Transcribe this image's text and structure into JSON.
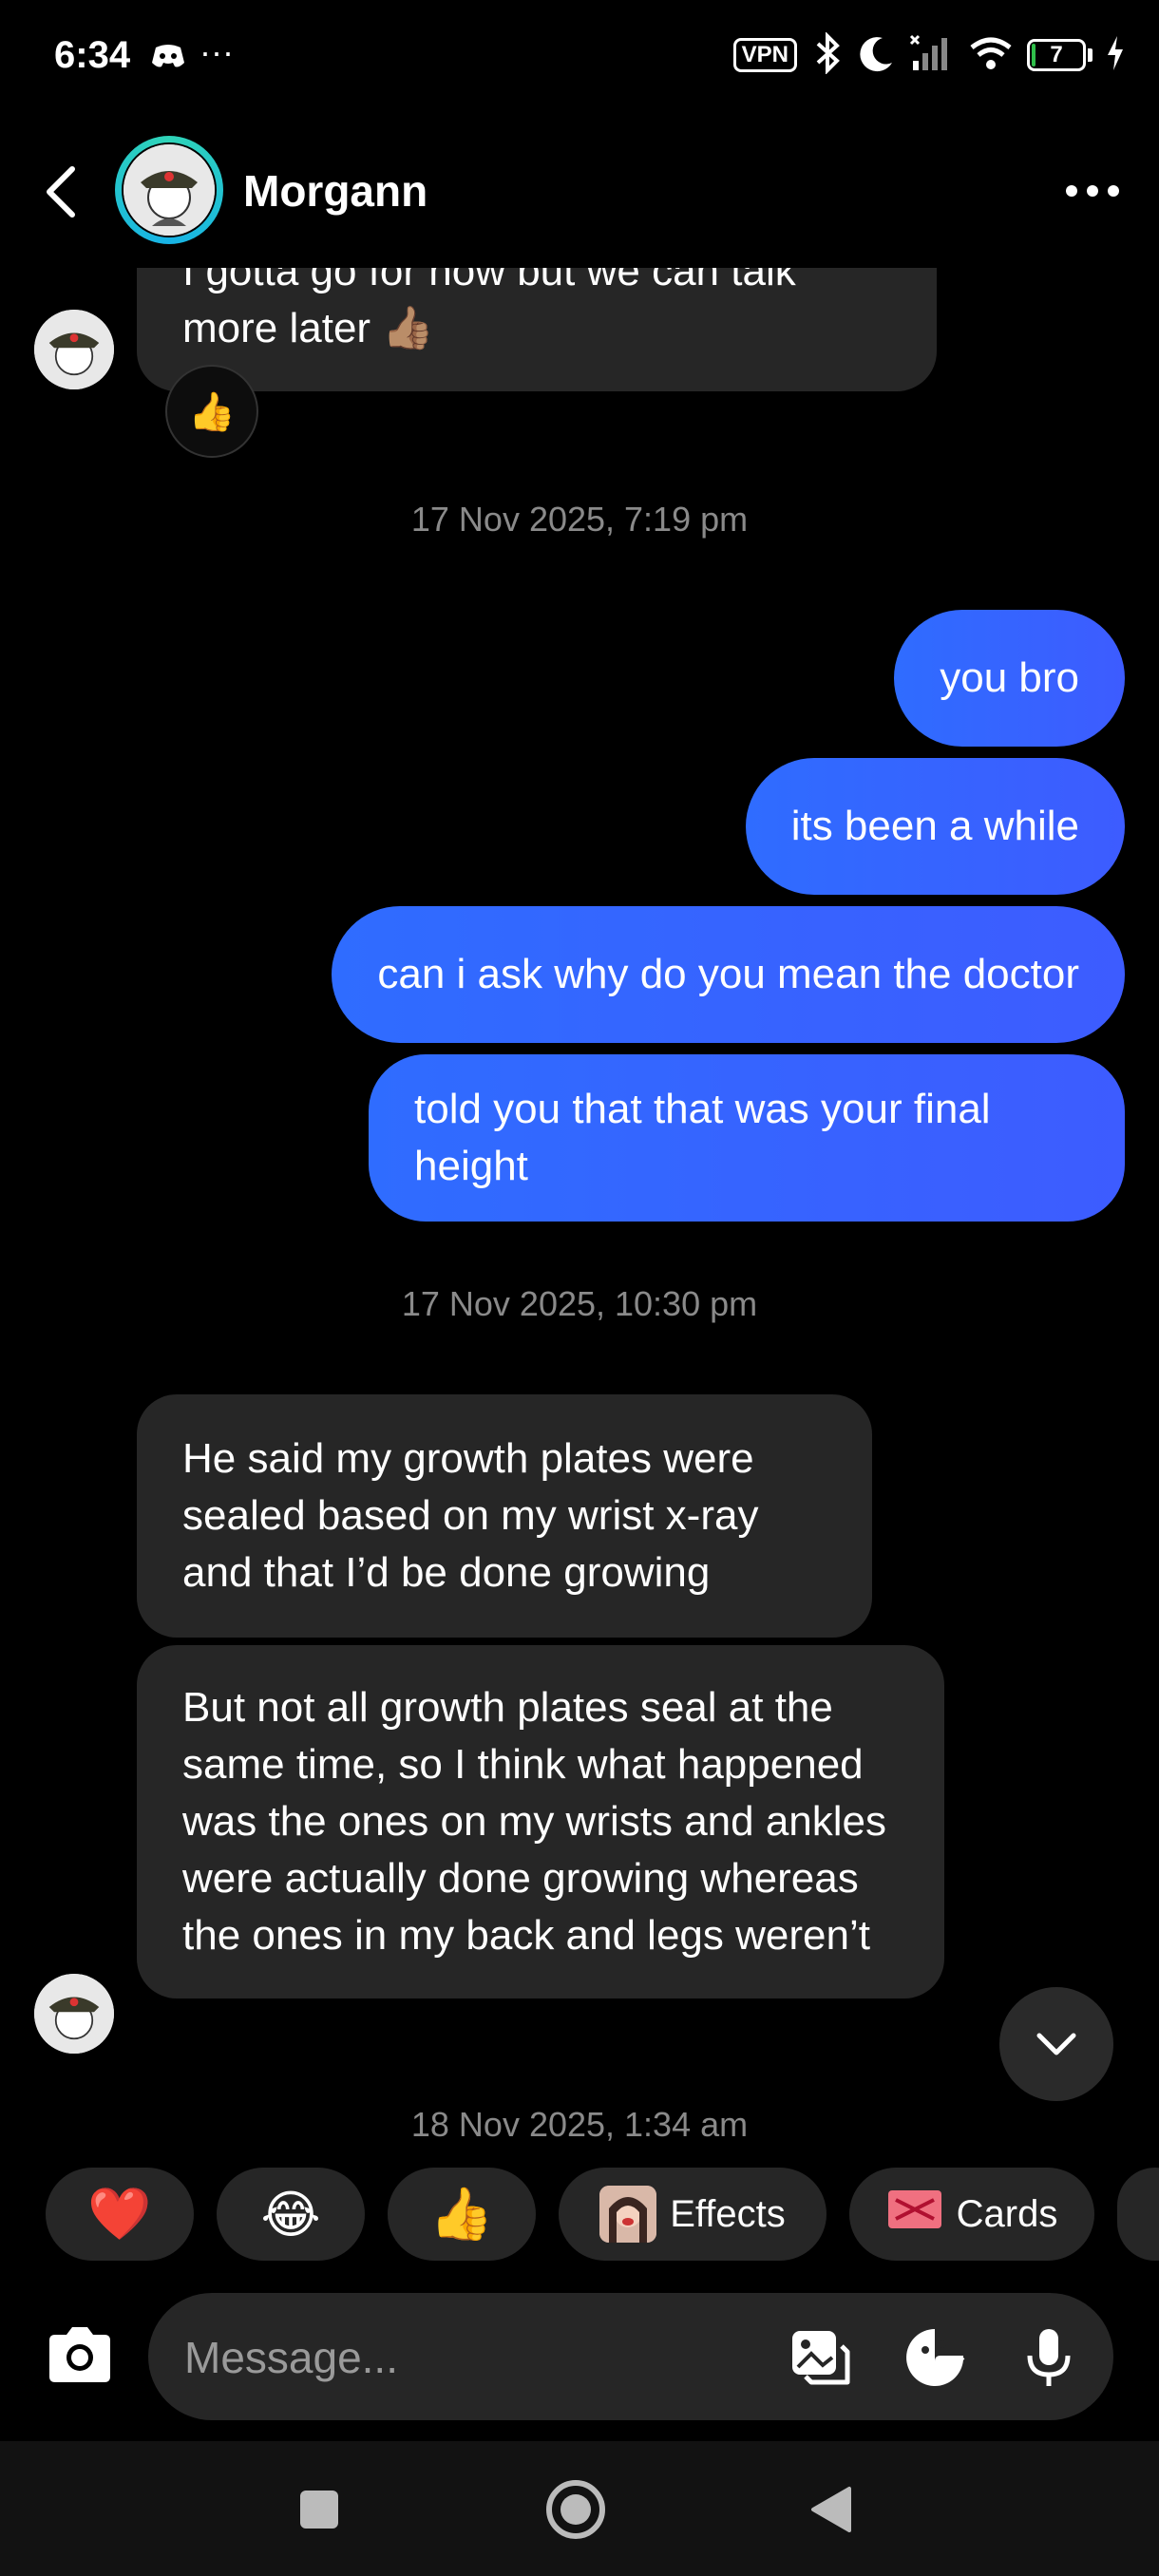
{
  "status_bar": {
    "time": "6:34",
    "overflow": "···",
    "vpn": "VPN",
    "battery_level": "7",
    "battery_fraction": 0.07
  },
  "header": {
    "contact_name": "Morgann"
  },
  "messages": [
    {
      "direction": "incoming",
      "text": "I gotta go for now but we can talk more later 👍🏽",
      "reaction": "👍"
    },
    {
      "type": "timestamp",
      "text": "17 Nov 2025, 7:19 pm"
    },
    {
      "direction": "outgoing",
      "text": "you bro"
    },
    {
      "direction": "outgoing",
      "text": "its been a while"
    },
    {
      "direction": "outgoing",
      "text": "can i ask why do you mean the doctor"
    },
    {
      "direction": "outgoing",
      "text": "told you that that was your final height"
    },
    {
      "type": "timestamp",
      "text": "17 Nov 2025, 10:30 pm"
    },
    {
      "direction": "incoming",
      "text": "He said my growth plates were sealed based on my wrist x-ray and that I’d be done growing"
    },
    {
      "direction": "incoming",
      "text": "But not all growth plates seal at the same time, so I think what happened was the ones on my wrists and ankles were actually done growing whereas the ones in my back and legs weren’t"
    },
    {
      "type": "timestamp",
      "text": "18 Nov 2025, 1:34 am"
    }
  ],
  "quick_reactions": [
    {
      "emoji": "❤️"
    },
    {
      "emoji": "😂"
    },
    {
      "emoji": "👍"
    },
    {
      "label": "Effects",
      "icon": "effects-avatar-icon"
    },
    {
      "label": "Cards",
      "icon": "gift-card-icon"
    }
  ],
  "composer": {
    "placeholder": "Message..."
  },
  "colors": {
    "outgoing_bubble": "#2f6cff",
    "incoming_bubble": "#262626",
    "background": "#000000",
    "story_ring": "#2fd4b8"
  }
}
